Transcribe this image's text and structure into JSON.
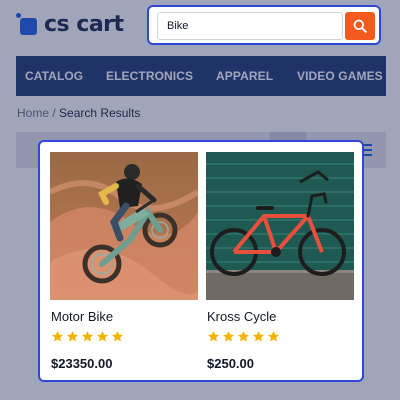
{
  "brand": {
    "logo_text": "cs cart",
    "accent": "#1e63e9"
  },
  "search": {
    "value": "Bike",
    "button_color": "#f25a1e"
  },
  "nav": {
    "items": [
      "CATALOG",
      "ELECTRONICS",
      "APPAREL",
      "VIDEO GAMES"
    ]
  },
  "breadcrumb": {
    "home": "Home",
    "separator": "/",
    "current": "Search Results"
  },
  "products": [
    {
      "name": "Motor Bike",
      "rating": 5,
      "price": "$23350.00"
    },
    {
      "name": "Kross Cycle",
      "rating": 5,
      "price": "$250.00"
    }
  ],
  "colors": {
    "highlight_border": "#2f48d9",
    "nav_bg": "#1f3b73",
    "star": "#f5b301"
  }
}
